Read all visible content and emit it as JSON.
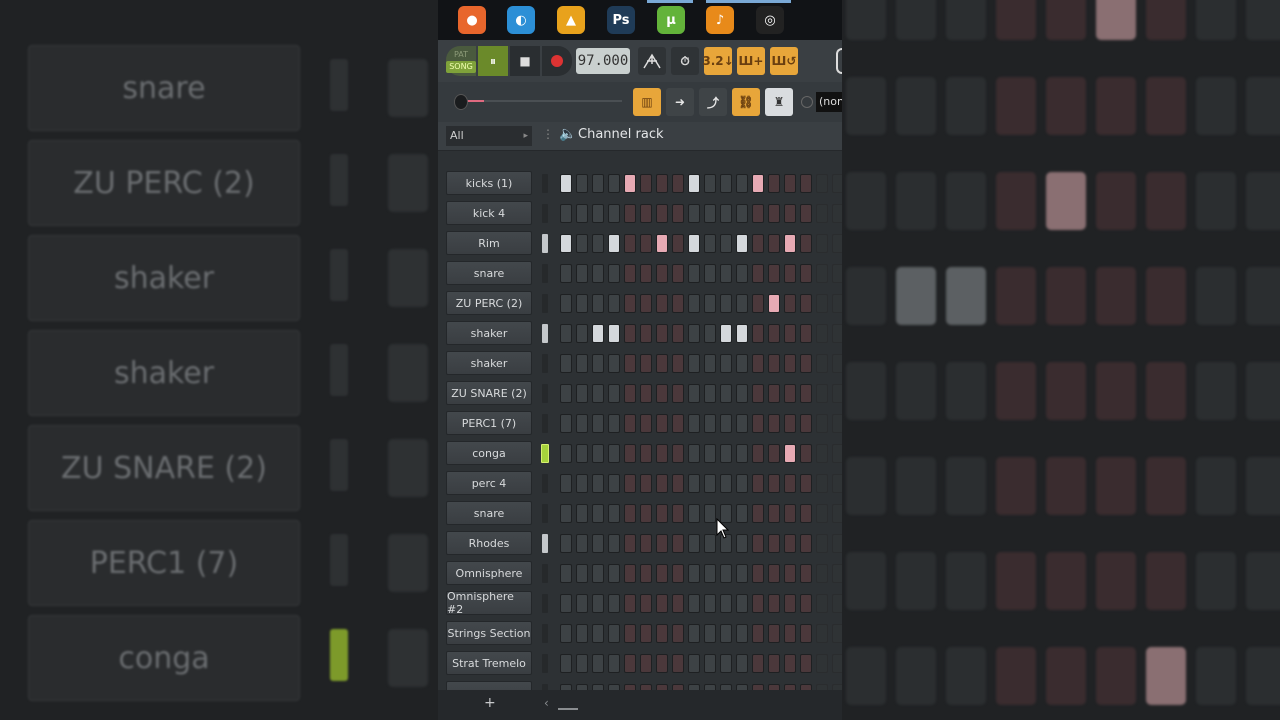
{
  "taskbar": {
    "apps": [
      {
        "name": "firefox-icon",
        "glyph": "●",
        "color": "#e8662c"
      },
      {
        "name": "edge-icon",
        "glyph": "◐",
        "color": "#2c8fd6"
      },
      {
        "name": "vlc-icon",
        "glyph": "▲",
        "color": "#e8a21c"
      },
      {
        "name": "photoshop-icon",
        "glyph": "Ps",
        "color": "#1f3b57"
      },
      {
        "name": "utorrent-icon",
        "glyph": "µ",
        "color": "#63b33a"
      },
      {
        "name": "fl-studio-icon",
        "glyph": "♪",
        "color": "#e88a1a"
      },
      {
        "name": "obs-icon",
        "glyph": "◎",
        "color": "#222"
      }
    ]
  },
  "transport": {
    "pat_label": "PAT",
    "song_label": "SONG",
    "pause_glyph": "⏸",
    "stop_glyph": "■",
    "tempo": "97.000"
  },
  "toolbar": {
    "counter_label": "3.2↓",
    "none_label": "(non"
  },
  "rack": {
    "filter": "All",
    "title": "Channel rack",
    "channels": [
      {
        "name": "kicks (1)",
        "led": "off",
        "on": [
          0,
          4,
          8,
          12
        ]
      },
      {
        "name": "kick 4",
        "led": "off",
        "on": []
      },
      {
        "name": "Rim",
        "led": "on",
        "on": [
          0,
          3,
          6,
          8,
          11,
          14
        ]
      },
      {
        "name": "snare",
        "led": "off",
        "on": []
      },
      {
        "name": "ZU PERC (2)",
        "led": "off",
        "on": [
          13
        ]
      },
      {
        "name": "shaker",
        "led": "on",
        "on": [
          2,
          3,
          10,
          11
        ]
      },
      {
        "name": "shaker",
        "led": "off",
        "on": []
      },
      {
        "name": "ZU SNARE (2)",
        "led": "off",
        "on": []
      },
      {
        "name": "PERC1 (7)",
        "led": "off",
        "on": []
      },
      {
        "name": "conga",
        "led": "sel",
        "on": [
          14
        ]
      },
      {
        "name": "perc 4",
        "led": "off",
        "on": []
      },
      {
        "name": "snare",
        "led": "off",
        "on": []
      },
      {
        "name": "Rhodes",
        "led": "on",
        "on": []
      },
      {
        "name": "Omnisphere",
        "led": "off",
        "on": []
      },
      {
        "name": "Omnisphere #2",
        "led": "off",
        "on": []
      },
      {
        "name": "Strings Section",
        "led": "off",
        "on": []
      },
      {
        "name": "Strat Tremelo",
        "led": "off",
        "on": []
      },
      {
        "name": "",
        "led": "off",
        "on": []
      }
    ]
  },
  "background": {
    "names": [
      "snare",
      "ZU PERC (2)",
      "shaker",
      "shaker",
      "ZU SNARE (2)",
      "PERC1 (7)",
      "conga"
    ]
  },
  "bottom": {
    "plus": "+",
    "arrow": "‹"
  },
  "colors": {
    "accent_orange": "#e8a63a",
    "led_green": "#a6d23c",
    "step_on": "#d4d8dc",
    "step_on_red": "#e7aab4"
  }
}
